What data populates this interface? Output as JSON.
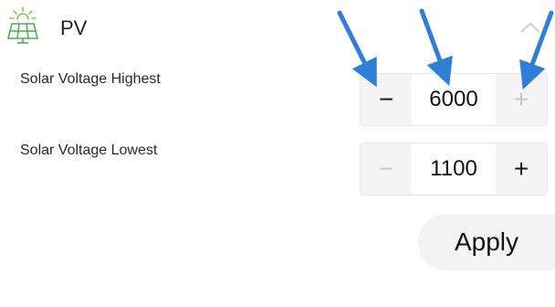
{
  "section": {
    "title": "PV",
    "icon": "solar-panel-icon",
    "collapse_icon": "chevron-up-icon"
  },
  "fields": [
    {
      "label": "Solar Voltage Highest",
      "value": "6000",
      "decrement_label": "−",
      "increment_label": "+",
      "decrement_enabled": true,
      "increment_enabled": false
    },
    {
      "label": "Solar Voltage Lowest",
      "value": "1100",
      "decrement_label": "−",
      "increment_label": "+",
      "decrement_enabled": false,
      "increment_enabled": true
    }
  ],
  "apply_label": "Apply",
  "colors": {
    "icon_green": "#4caf50",
    "icon_sun": "#8bc34a",
    "annotation_arrow": "#2f7fd8",
    "disabled": "#c8c8c8"
  }
}
